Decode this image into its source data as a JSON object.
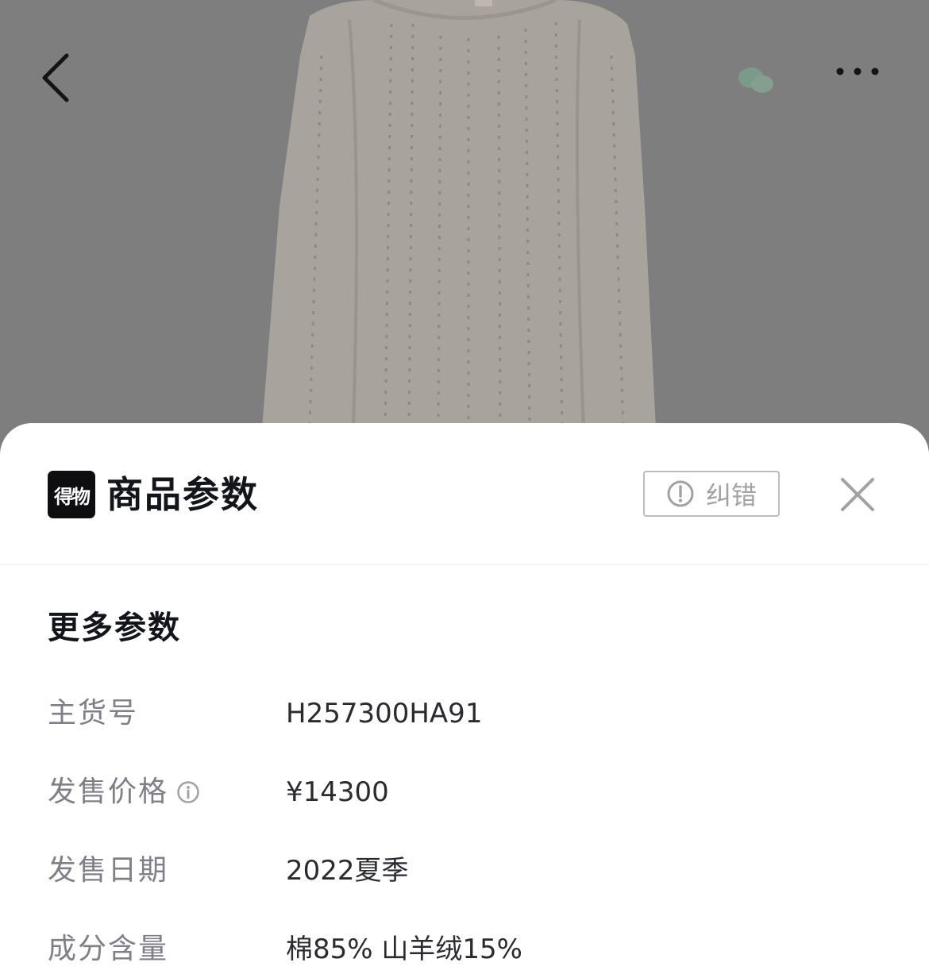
{
  "icons": {
    "back": "back-chevron-icon",
    "wechat": "wechat-icon",
    "more": "more-dots-icon",
    "report": "exclamation-circle-icon",
    "close": "close-icon",
    "info": "info-icon"
  },
  "sheet": {
    "brand_logo_text": "得物",
    "title": "商品参数",
    "report_label": "纠错",
    "section_title": "更多参数",
    "params": [
      {
        "label": "主货号",
        "value": "H257300HA91"
      },
      {
        "label": "发售价格",
        "value": "¥14300"
      },
      {
        "label": "发售日期",
        "value": "2022夏季"
      },
      {
        "label": "成分含量",
        "value": "棉85% 山羊绒15%"
      }
    ]
  },
  "colors": {
    "overlay": "#7f7f80",
    "sheet_bg": "#ffffff",
    "title_text": "#14151a",
    "label_text": "#7f7f87",
    "value_text": "#2a2b31",
    "muted_border": "#bdbdc1"
  }
}
